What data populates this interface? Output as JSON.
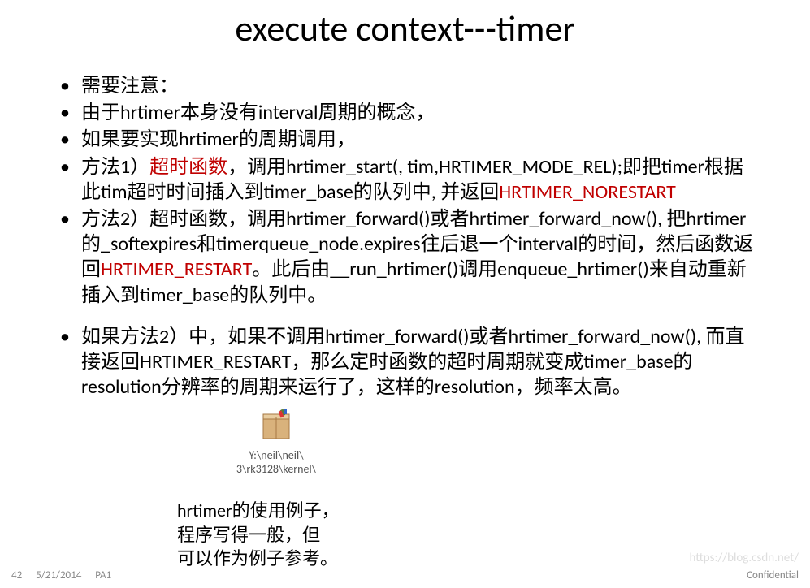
{
  "title": "execute context---timer",
  "bullets": {
    "b1": "需要注意：",
    "b2": "由于hrtimer本身没有interval周期的概念，",
    "b3": "如果要实现hrtimer的周期调用，",
    "b4_pre": "方法1）",
    "b4_red": "超时函数",
    "b4_mid": "，调用hrtimer_start(, tim,HRTIMER_MODE_REL);即把timer根据此tim超时时间插入到timer_base的队列中, 并返回",
    "b4_red2": "HRTIMER_NORESTART",
    "b5_pre": "方法2）超时函数，调用hrtimer_forward()或者hrtimer_forward_now(), 把hrtimer的_softexpires和timerqueue_node.expires往后退一个interval的时间，然后函数返回",
    "b5_red": "HRTIMER_RESTART",
    "b5_post": "。此后由__run_hrtimer()调用enqueue_hrtimer()来自动重新插入到timer_base的队列中。",
    "b6": "如果方法2）中，如果不调用hrtimer_forward()或者hrtimer_forward_now(), 而直接返回HRTIMER_RESTART，那么定时函数的超时周期就变成timer_base的resolution分辨率的周期来运行了，这样的resolution，频率太高。"
  },
  "file_caption_line1": "Y:\\neil\\neil\\",
  "file_caption_line2": "3\\rk3128\\kernel\\",
  "notes_line1": "hrtimer的使用例子，",
  "notes_line2": "程序写得一般，但",
  "notes_line3": "可以作为例子参考。",
  "footer": {
    "slide_num": "42",
    "date": "5/21/2014",
    "code": "PA1",
    "confidential": "Confidential"
  },
  "watermark": "https://blog.csdn.net/"
}
